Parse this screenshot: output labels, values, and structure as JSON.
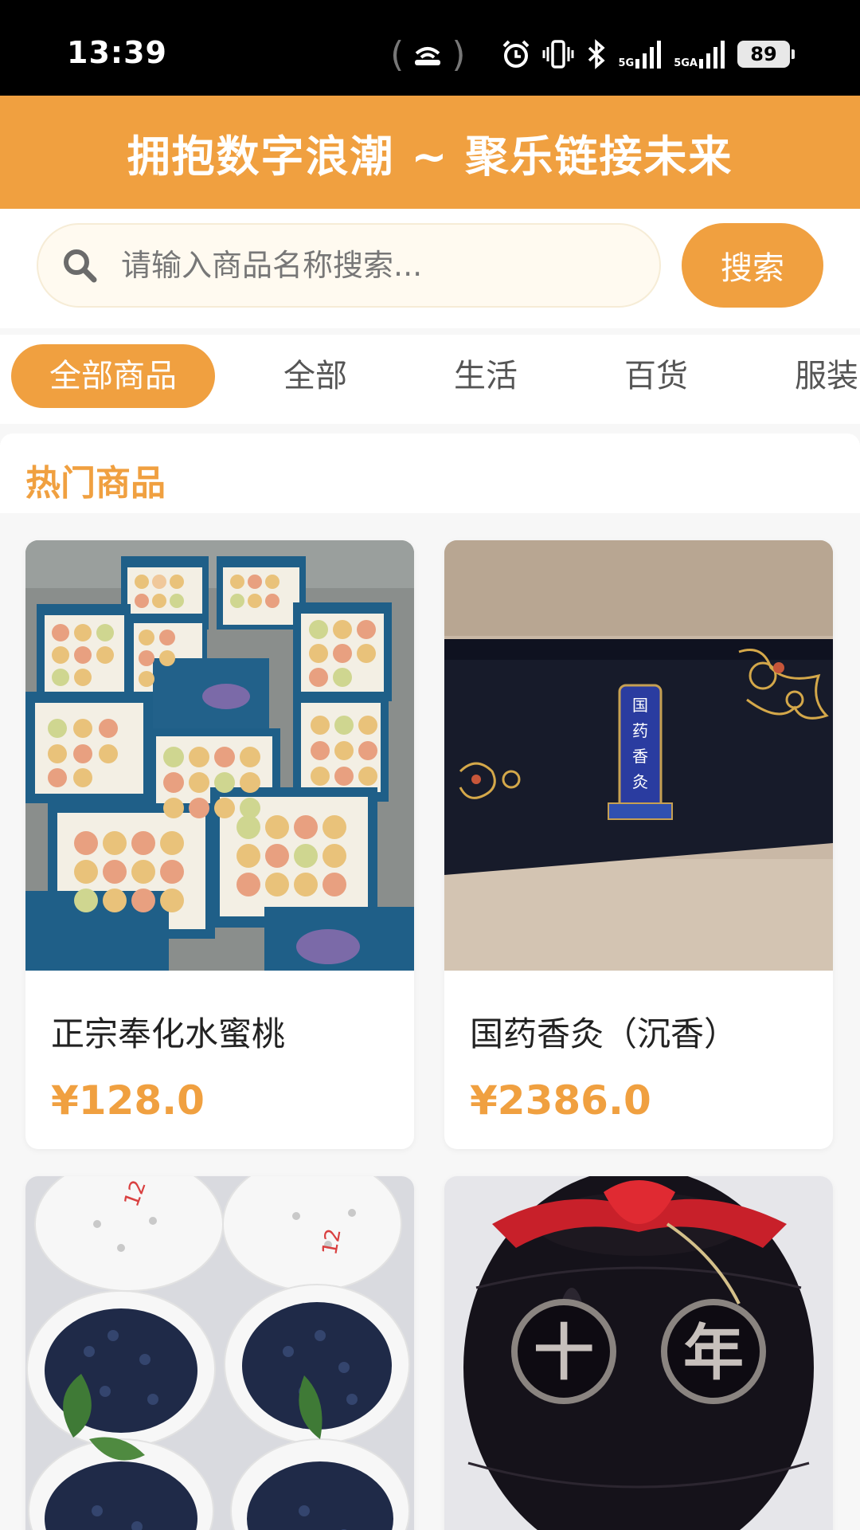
{
  "status_bar": {
    "time": "13:39",
    "network_1": "5G",
    "network_2": "5GA",
    "battery": "89",
    "icons": [
      "hotspot-icon",
      "alarm-icon",
      "vibrate-icon",
      "bluetooth-icon",
      "signal-icon",
      "signal-icon"
    ]
  },
  "banner": {
    "title": "拥抱数字浪潮 ~ 聚乐链接未来"
  },
  "search": {
    "placeholder": "请输入商品名称搜索...",
    "button_label": "搜索"
  },
  "categories": {
    "active": "全部商品",
    "items": [
      "全部商品",
      "全部",
      "生活",
      "百货",
      "服装"
    ]
  },
  "section": {
    "title": "热门商品"
  },
  "products": [
    {
      "name": "正宗奉化水蜜桃",
      "price": "¥128.0",
      "image": "peach-gift-boxes-photo"
    },
    {
      "name": "国药香灸（沉香）",
      "price": "¥2386.0",
      "image": "moxibustion-box-photo"
    },
    {
      "name": "",
      "price": "",
      "image": "blueberry-baskets-photo"
    },
    {
      "name": "",
      "price": "",
      "image": "wine-jar-photo"
    }
  ],
  "colors": {
    "accent": "#f0a040",
    "banner": "#f0a040",
    "background": "#f7f7f7"
  }
}
